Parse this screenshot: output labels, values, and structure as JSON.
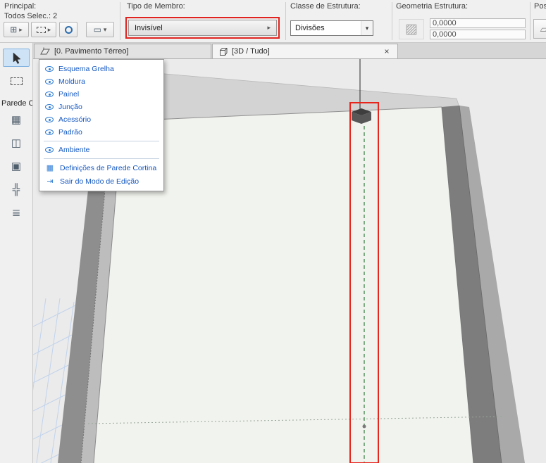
{
  "colors": {
    "highlight_red": "#e0231f",
    "menu_blue": "#1659c2",
    "eye_blue": "#2e7cd6",
    "selection_green": "#3f8448",
    "floor_grid_blue": "#c1d3ec"
  },
  "icons": {
    "menu_arrow": "▸",
    "combo_arrow": "▾",
    "close": "×",
    "btn1_glyph": "⊞",
    "btn4_glyph": "▭",
    "geometry_hatch": "▨",
    "position_glyph": "▱",
    "settings_grid": "▦",
    "exit": "⇥",
    "tool_scheme": "▦",
    "tool_frame": "◫",
    "tool_panel": "▣",
    "tool_junction": "╬",
    "tool_accessory": "≣"
  },
  "toolbar": {
    "principal": {
      "label": "Principal:",
      "status": "Todos Selec.: 2"
    },
    "member_type": {
      "label": "Tipo de Membro:",
      "value": "Invisível"
    },
    "structure_class": {
      "label": "Classe de Estrutura:",
      "value": "Divisões"
    },
    "structure_geometry": {
      "label": "Geometria Estrutura:",
      "value1": "0,0000",
      "value2": "0,0000"
    },
    "position": {
      "label": "Posiç"
    }
  },
  "tabs": {
    "floor": "[0. Pavimento Térreo]",
    "three_d": "[3D / Tudo]"
  },
  "sidebar": {
    "group_label": "Parede C"
  },
  "menu": {
    "items": [
      {
        "label": "Esquema Grelha"
      },
      {
        "label": "Moldura"
      },
      {
        "label": "Painel"
      },
      {
        "label": "Junção"
      },
      {
        "label": "Acessório"
      },
      {
        "label": "Padrão"
      },
      {
        "label": "Ambiente"
      },
      {
        "label": "Definições de Parede Cortina"
      },
      {
        "label": "Sair do Modo de Edição"
      }
    ]
  }
}
